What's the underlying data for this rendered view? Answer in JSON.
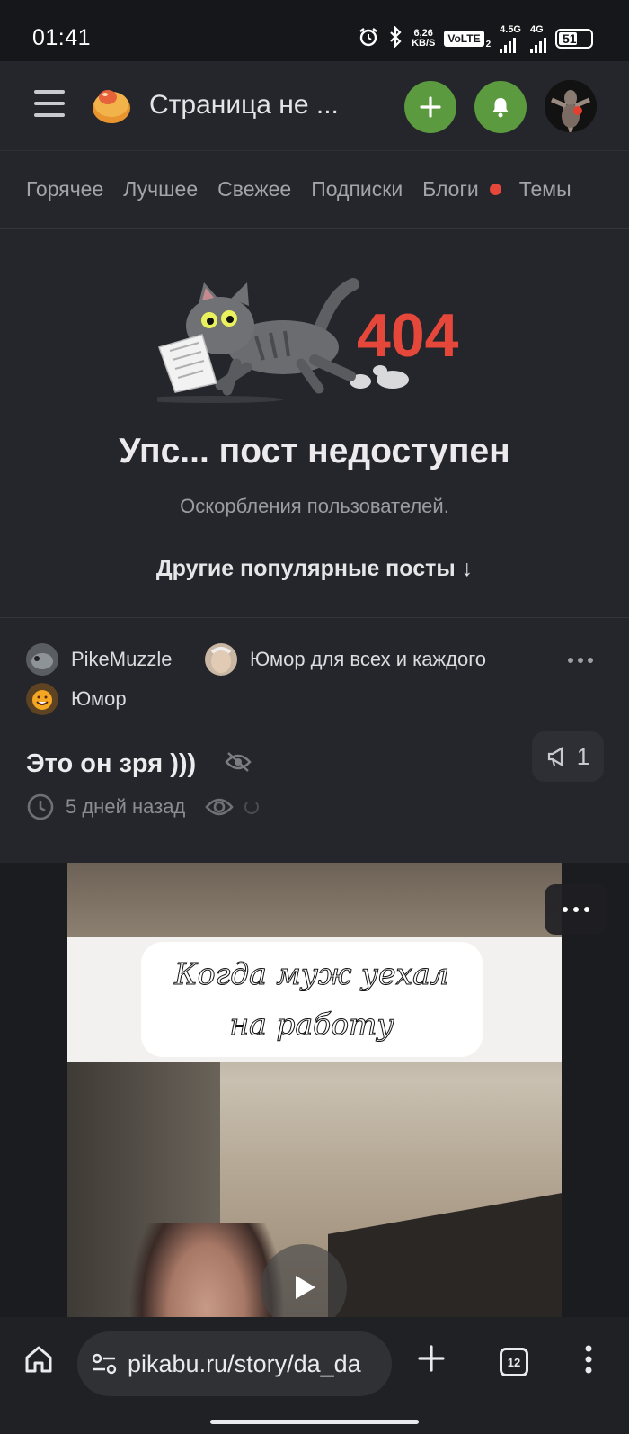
{
  "status_bar": {
    "time": "01:41",
    "speed_value": "6,26",
    "speed_unit": "KB/S",
    "volte": "VoLTE",
    "sim1_badge": "2",
    "net1": "4.5G",
    "net2": "4G",
    "battery": "51",
    "icons": [
      "alarm-icon",
      "bluetooth-icon",
      "signal-icon",
      "battery-icon"
    ]
  },
  "header": {
    "title": "Страница не ...",
    "actions": [
      "plus-icon",
      "bell-icon"
    ],
    "accent_color": "#5b9a3e"
  },
  "tabs": [
    "Горячее",
    "Лучшее",
    "Свежее",
    "Подписки",
    "Блоги",
    "Темы"
  ],
  "not_found": {
    "code": "404",
    "heading": "Упс... пост недоступен",
    "reason": "Оскорбления пользователей.",
    "more_posts": "Другие популярные посты ↓"
  },
  "post": {
    "author": "PikeMuzzle",
    "community": "Юмор для всех и каждого",
    "tag": "Юмор",
    "title": "Это он зря )))",
    "rating": "1",
    "time": "5 дней назад",
    "video_caption_line1": "Когда муж уехал",
    "video_caption_line2": "на работу"
  },
  "browser": {
    "url": "pikabu.ru/story/da_da",
    "tab_count": "12"
  },
  "colors": {
    "background": "#1c1d21",
    "surface": "#25262b",
    "error_red": "#e5473a",
    "green": "#5b9a3e"
  }
}
